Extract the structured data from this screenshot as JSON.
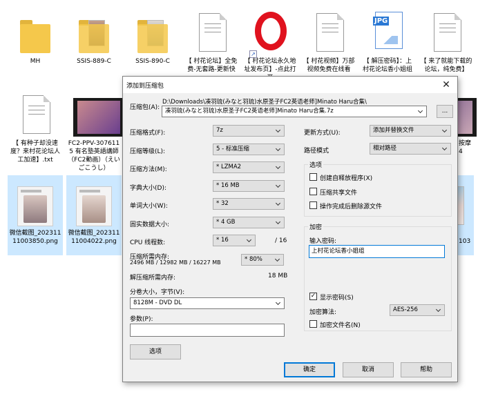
{
  "explorer": {
    "row1": [
      {
        "label": "MH",
        "kind": "folder"
      },
      {
        "label": "SSIS-889-C",
        "kind": "folder-img"
      },
      {
        "label": "SSIS-890-C",
        "kind": "folder-img"
      },
      {
        "label": "【 村花论坛】全免费-无套路-更新快",
        "kind": "doc"
      },
      {
        "label": "【 村花论坛永久地址发布页】-点此打开",
        "kind": "opera"
      },
      {
        "label": "【 村花视频】万部视频免费在线看",
        "kind": "doc"
      },
      {
        "label": "【 解压密码】：上村花论坛香小姐组",
        "kind": "jpg",
        "badge": "JPG"
      },
      {
        "label": "【 来了就能下载的论坛，纯免费】",
        "kind": "doc"
      }
    ],
    "row2": [
      {
        "label": "【 有种子却没速度？来村花论坛人工加速】.txt",
        "kind": "doc"
      },
      {
        "label": "FC2-PPV-3076115 有名塾英語講師（FC2動画）（えいごこうし）",
        "kind": "video"
      }
    ],
    "row2_right_label": "按摩 4",
    "row3": [
      {
        "label": "微信截图_20231111003850.png",
        "kind": "photo"
      },
      {
        "label": "微信截图_20231111004022.png",
        "kind": "photo"
      }
    ],
    "row3_right_label": "103"
  },
  "dialog": {
    "title": "添加到压缩包",
    "close_glyph": "✕",
    "archive": {
      "label": "压缩包(A):",
      "path": "D:\\Downloads\\凑羽琉(みなと羽琉)水原圣子FC2英语老师]Minato Haru合集\\",
      "name": "凑羽琉(みなと羽琉)水原圣子FC2英语老师]Minato Haru合集.7z",
      "browse": "..."
    },
    "left_fields": [
      {
        "label": "压缩格式(F):",
        "value": "7z"
      },
      {
        "label": "压缩等级(L):",
        "value": "5 - 标准压缩"
      },
      {
        "label": "压缩方法(M):",
        "value": "* LZMA2"
      },
      {
        "label": "字典大小(D):",
        "value": "* 16 MB"
      },
      {
        "label": "单词大小(W):",
        "value": "* 32"
      },
      {
        "label": "固实数据大小:",
        "value": "* 4 GB"
      }
    ],
    "cpu": {
      "label": "CPU 线程数:",
      "value": "* 16",
      "max": "/ 16"
    },
    "memory": {
      "label": "压缩所需内存:",
      "detail": "2496 MB / 12982 MB / 16227 MB",
      "value": "* 80%"
    },
    "decompress_memory": {
      "label": "解压缩所需内存:",
      "value": "18 MB"
    },
    "split": {
      "label": "分卷大小，字节(V):",
      "value": "8128M - DVD DL"
    },
    "params": {
      "label": "参数(P):",
      "value": ""
    },
    "options_button": "选项",
    "update_mode": {
      "label": "更新方式(U):",
      "value": "添加并替换文件"
    },
    "path_mode": {
      "label": "路径模式",
      "value": "相对路径"
    },
    "options_group": {
      "title": "选项",
      "items": [
        {
          "label": "创建自释放程序(X)",
          "checked": false
        },
        {
          "label": "压缩共享文件",
          "checked": false
        },
        {
          "label": "操作完成后删除源文件",
          "checked": false
        }
      ]
    },
    "encryption": {
      "title": "加密",
      "password_label": "输入密码:",
      "password": "上村花论坛香小姐组",
      "show_password": {
        "label": "显示密码(S)",
        "checked": true
      },
      "method_label": "加密算法:",
      "method": "AES-256",
      "encrypt_names": {
        "label": "加密文件名(N)",
        "checked": false
      }
    },
    "buttons": {
      "ok": "确定",
      "cancel": "取消",
      "help": "帮助"
    }
  }
}
